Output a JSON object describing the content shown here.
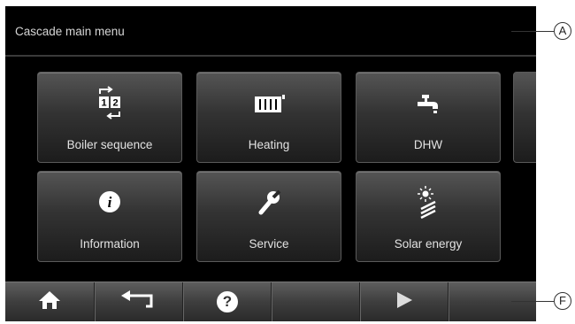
{
  "header": {
    "title": "Cascade main menu"
  },
  "tiles": [
    {
      "label": "Boiler sequence",
      "icon": "boiler-sequence-icon"
    },
    {
      "label": "Heating",
      "icon": "radiator-icon"
    },
    {
      "label": "DHW",
      "icon": "tap-icon"
    },
    {
      "label": "Information",
      "icon": "info-icon"
    },
    {
      "label": "Service",
      "icon": "wrench-icon"
    },
    {
      "label": "Solar energy",
      "icon": "solar-icon"
    }
  ],
  "boiler_icon_digits": [
    "1",
    "2"
  ],
  "toolbar": {
    "help_glyph": "?"
  },
  "callouts": {
    "a": "A",
    "f": "F"
  },
  "colors": {
    "screen_bg": "#000000",
    "tile_text": "#e2e2e2",
    "toolbar": "#4a4a4a"
  }
}
